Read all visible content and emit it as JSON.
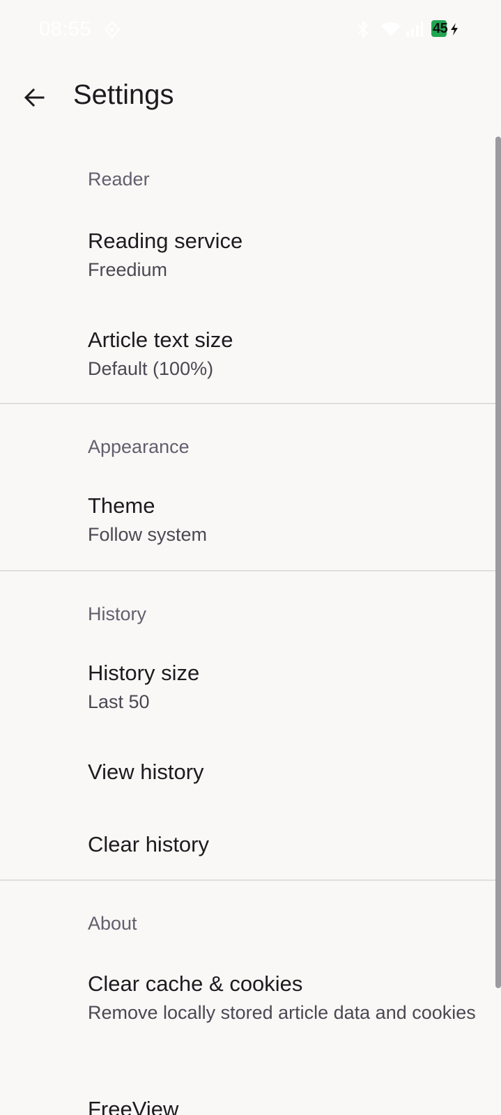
{
  "status_bar": {
    "time": "08:55",
    "battery_level": "45",
    "colors": {
      "battery": "#21a652",
      "time": "#ffffff"
    }
  },
  "app_bar": {
    "title": "Settings",
    "back_icon": "arrow-left-icon"
  },
  "sections": {
    "reader": {
      "header": "Reader",
      "reading_service": {
        "title": "Reading service",
        "value": "Freedium"
      },
      "article_text_size": {
        "title": "Article text size",
        "value": "Default (100%)"
      }
    },
    "appearance": {
      "header": "Appearance",
      "theme": {
        "title": "Theme",
        "value": "Follow system"
      }
    },
    "history": {
      "header": "History",
      "history_size": {
        "title": "History size",
        "value": "Last 50"
      },
      "view_history": {
        "title": "View history"
      },
      "clear_history": {
        "title": "Clear history"
      }
    },
    "about": {
      "header": "About",
      "clear_cache": {
        "title": "Clear cache & cookies",
        "value": "Remove locally stored article data and cookies"
      },
      "freeview": {
        "title": "FreeView"
      }
    }
  },
  "theme_colors": {
    "background": "#faf8f6",
    "section_header": "#625f6e",
    "primary_text": "#1c1b1f",
    "secondary_text": "#4a4852",
    "divider": "#e0dde0",
    "scrollbar": "#9b9aa0"
  }
}
